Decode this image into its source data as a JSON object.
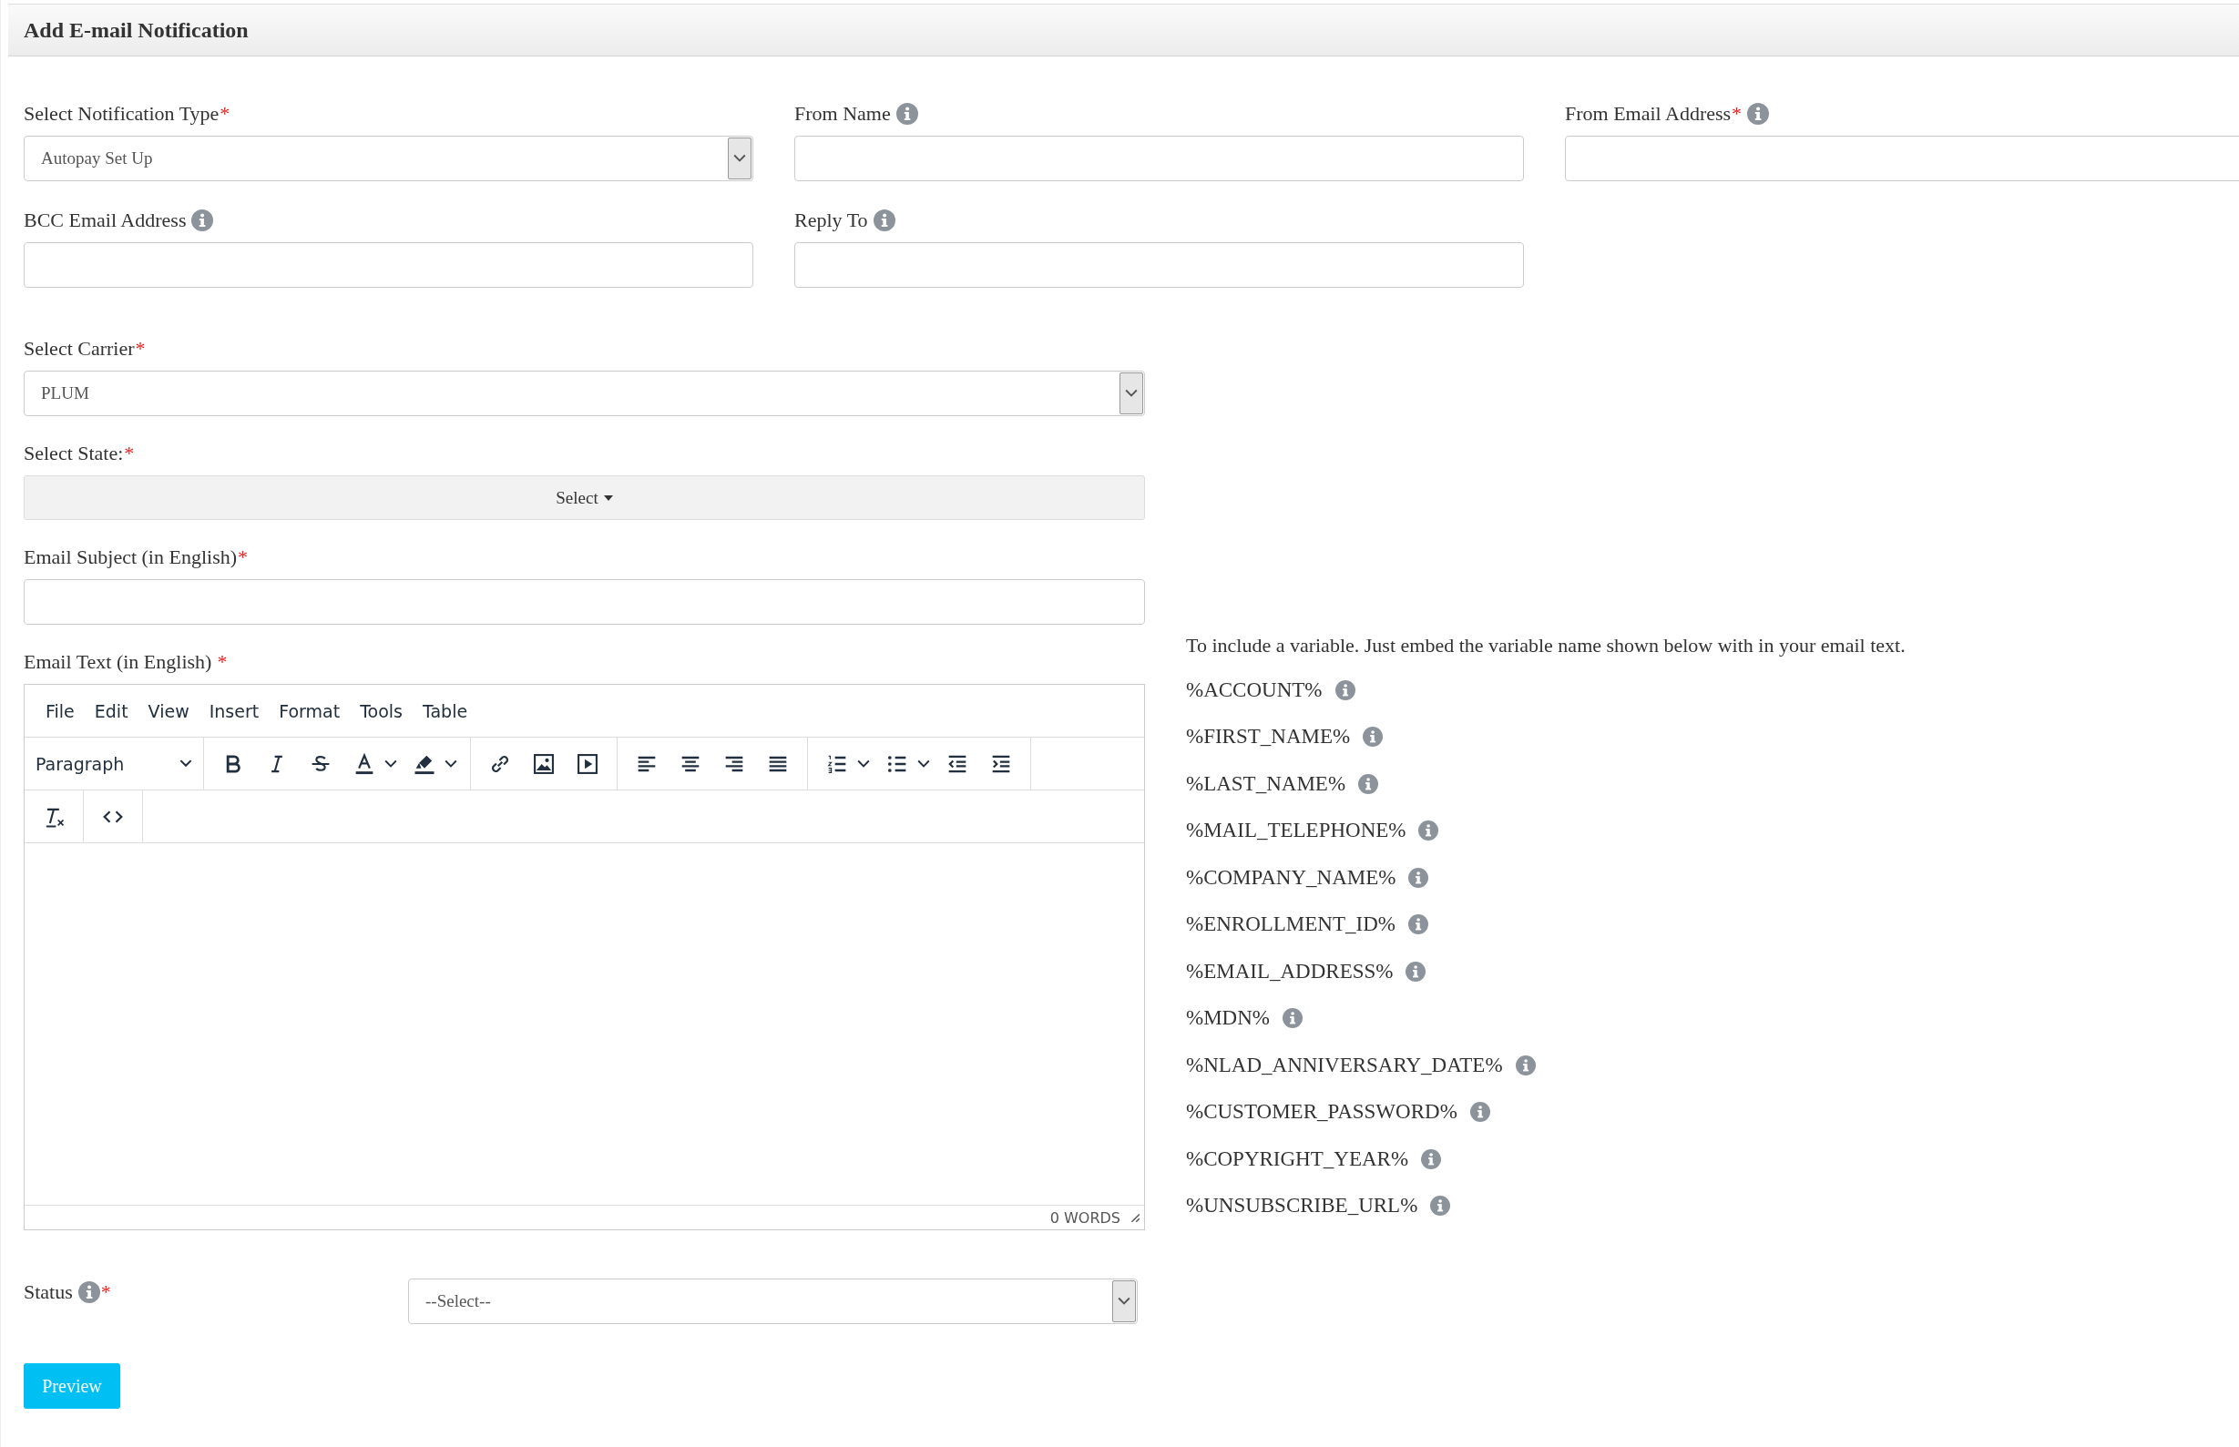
{
  "header": {
    "title": "Add E-mail Notification"
  },
  "top_fields": [
    {
      "label": "Select Notification Type",
      "required_mark": "*",
      "info": false,
      "kind": "select",
      "value": "Autopay Set Up"
    },
    {
      "label": "From Name",
      "info": true,
      "kind": "input"
    },
    {
      "label": "From Email Address",
      "required_mark": "*",
      "info": true,
      "kind": "input"
    },
    {
      "label": "BCC Email Address",
      "info": true,
      "kind": "input"
    },
    {
      "label": "Reply To",
      "info": true,
      "kind": "input"
    }
  ],
  "carrier": {
    "label": "Select Carrier",
    "required_mark": "*",
    "value": "PLUM"
  },
  "state": {
    "label": "Select State:",
    "required_mark": "*",
    "button": "Select"
  },
  "subject": {
    "label": "Email Subject (in English)",
    "required_mark": "*"
  },
  "email_text": {
    "label": "Email Text (in English)",
    "required_mark": "*"
  },
  "editor": {
    "menu": [
      "File",
      "Edit",
      "View",
      "Insert",
      "Format",
      "Tools",
      "Table"
    ],
    "block_format": "Paragraph",
    "word_count": "0 WORDS"
  },
  "variables": {
    "intro": "To include a variable. Just embed the variable name shown below with in your email text.",
    "items": [
      "%ACCOUNT%",
      "%FIRST_NAME%",
      "%LAST_NAME%",
      "%MAIL_TELEPHONE%",
      "%COMPANY_NAME%",
      "%ENROLLMENT_ID%",
      "%EMAIL_ADDRESS%",
      "%MDN%",
      "%NLAD_ANNIVERSARY_DATE%",
      "%CUSTOMER_PASSWORD%",
      "%COPYRIGHT_YEAR%",
      "%UNSUBSCRIBE_URL%"
    ]
  },
  "status": {
    "label": "Status",
    "info": true,
    "required_mark": "*",
    "mark_after_info": true,
    "value": "--Select--"
  },
  "preview_button": "Preview"
}
